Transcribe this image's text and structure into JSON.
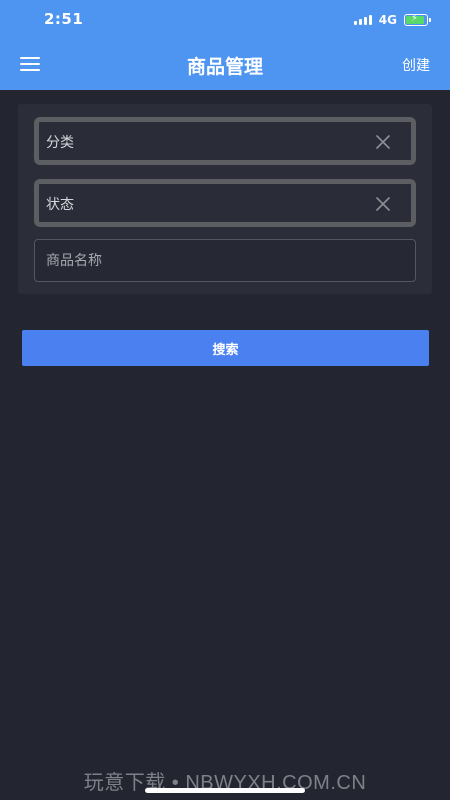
{
  "status_bar": {
    "time": "2:51",
    "network": "4G",
    "signal_icon": "signal-icon",
    "battery_icon": "battery-charging-icon",
    "battery_color": "#59d86b"
  },
  "nav": {
    "menu_icon": "menu-icon",
    "title": "商品管理",
    "create_label": "创建",
    "background_color": "#4e95f2"
  },
  "filters": {
    "category_label": "分类",
    "status_label": "状态",
    "clear_icon": "close-icon",
    "product_name_placeholder": "商品名称",
    "product_name_value": ""
  },
  "search_button": {
    "label": "搜索",
    "color": "#4a80ef"
  },
  "watermark": {
    "text": "玩意下载 • NBWYXH.COM.CN"
  }
}
